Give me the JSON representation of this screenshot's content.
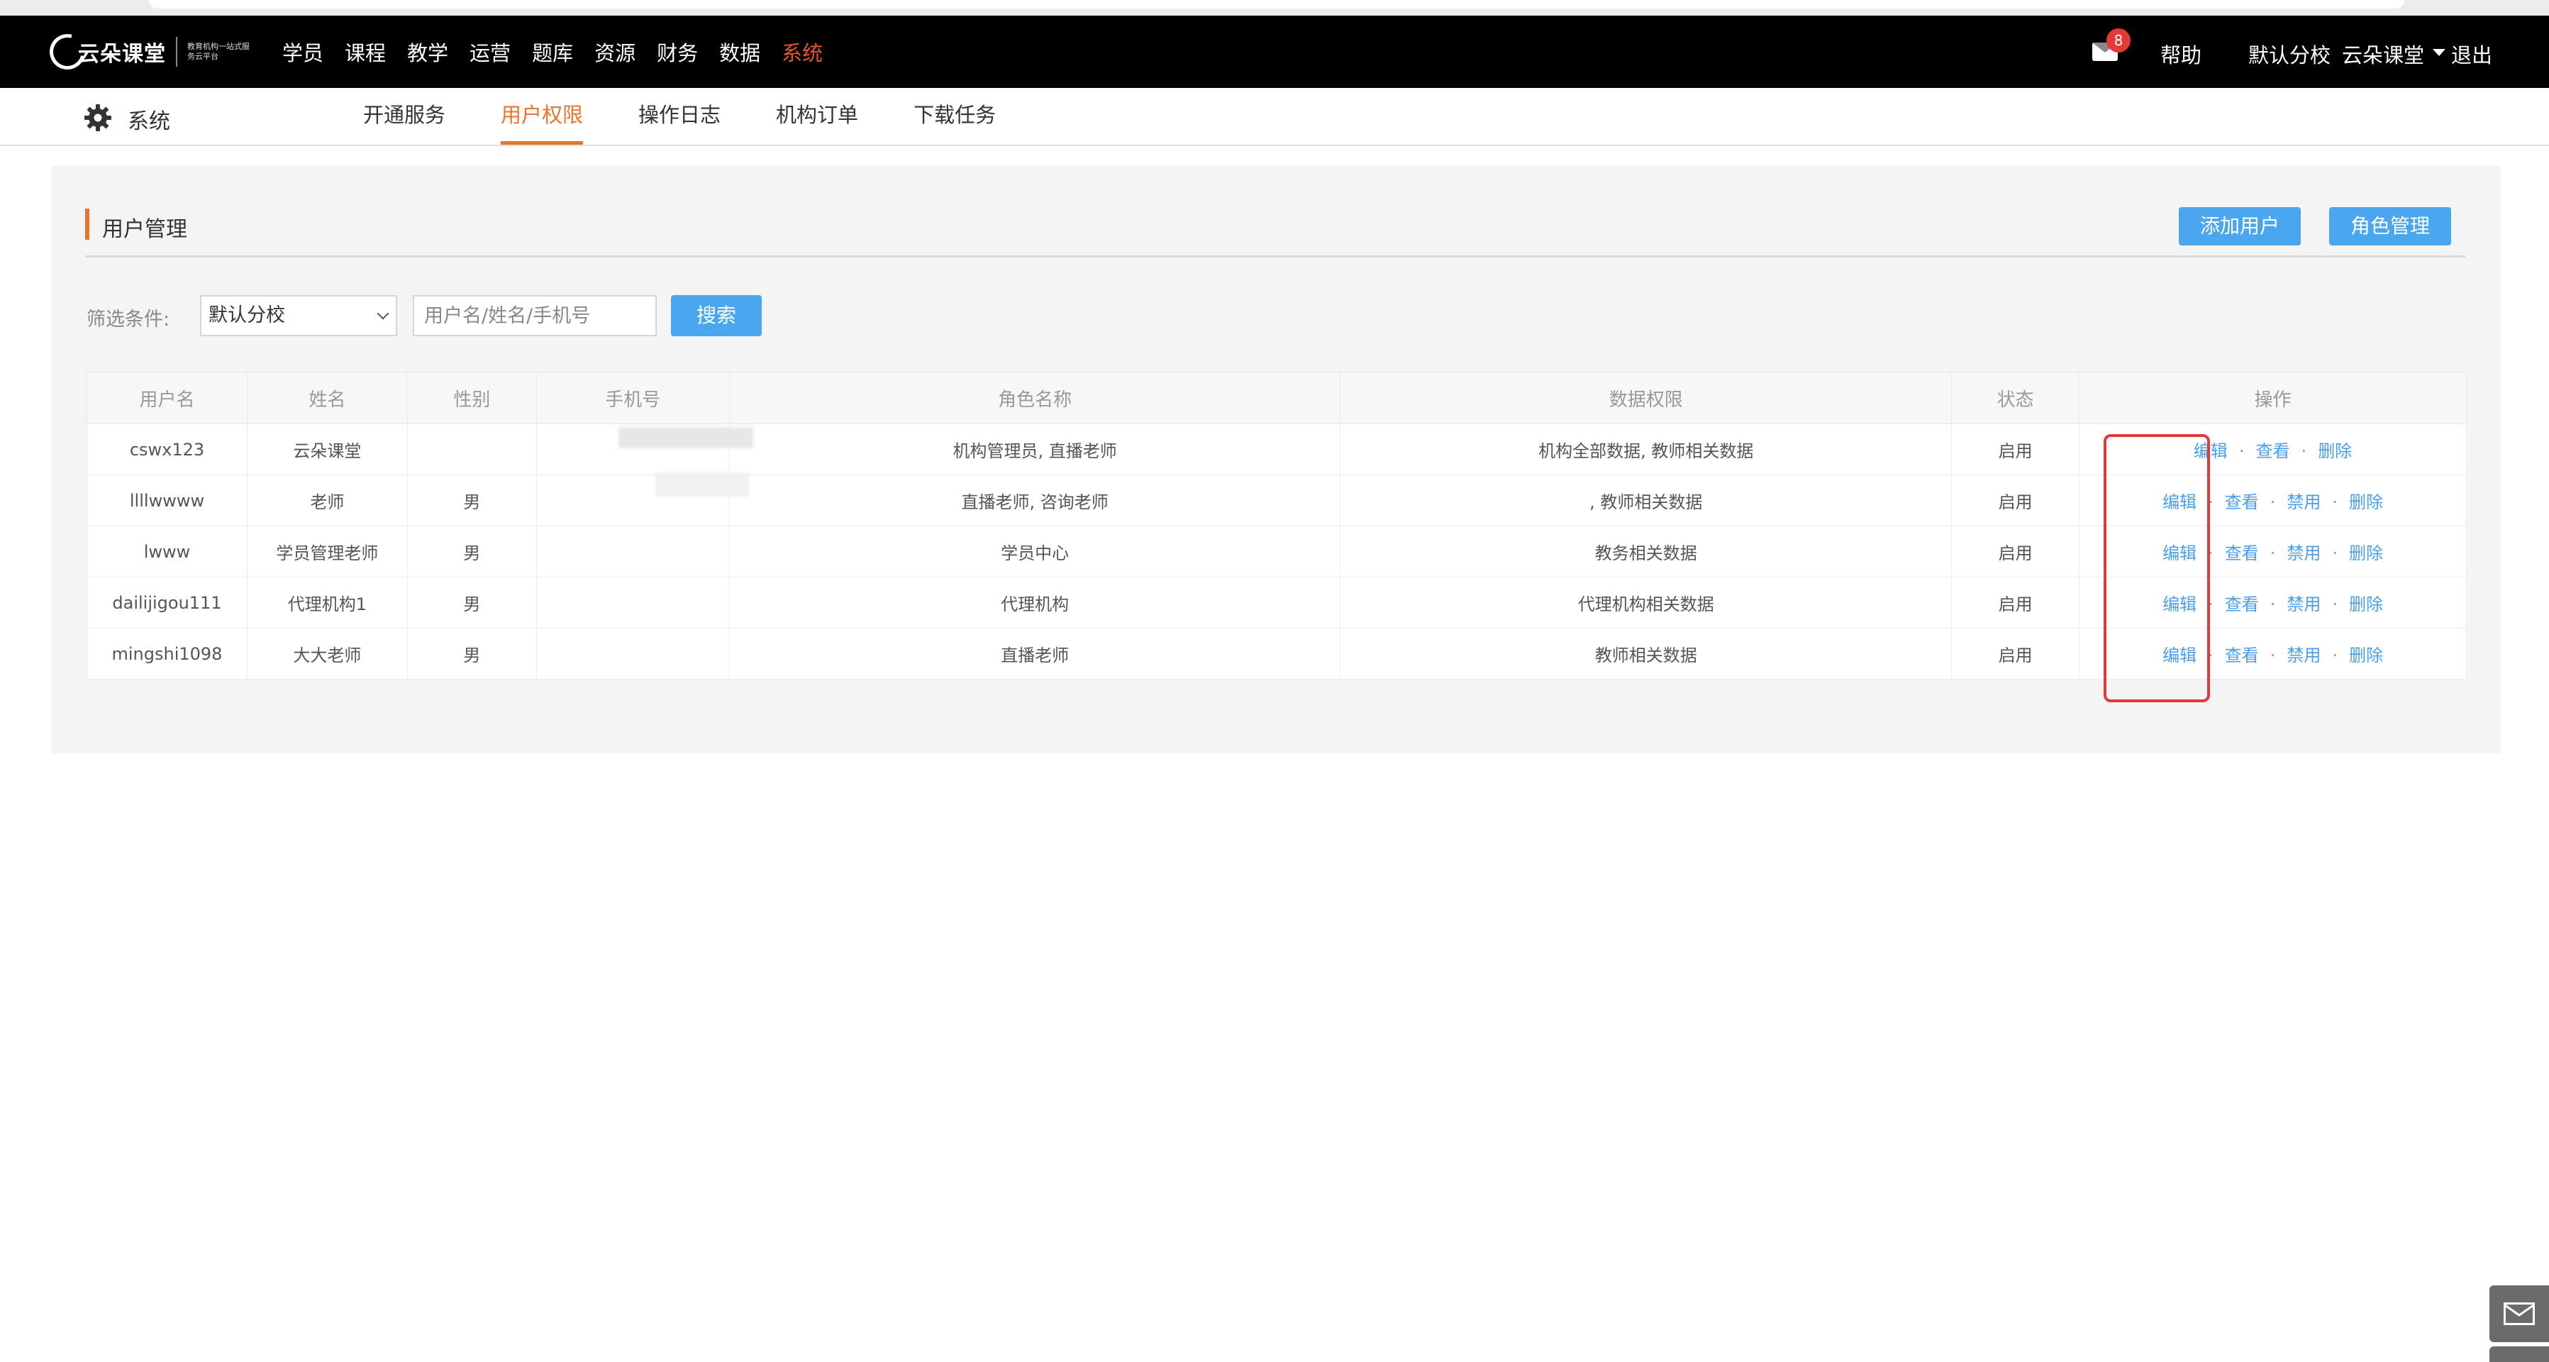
{
  "brand": {
    "name": "云朵课堂",
    "tagline": "教育机构一站式服务云平台"
  },
  "topnav": {
    "items": [
      "学员",
      "课程",
      "教学",
      "运营",
      "题库",
      "资源",
      "财务",
      "数据",
      "系统"
    ],
    "active": "系统"
  },
  "header_right": {
    "message_count": "8",
    "help": "帮助",
    "branch": "默认分校",
    "account": "云朵课堂",
    "logout": "退出"
  },
  "module": {
    "title": "系统",
    "tabs": [
      "开通服务",
      "用户权限",
      "操作日志",
      "机构订单",
      "下载任务"
    ],
    "active_tab": "用户权限"
  },
  "panel": {
    "title": "用户管理",
    "add_user": "添加用户",
    "role_manage": "角色管理"
  },
  "filter": {
    "label": "筛选条件:",
    "branch_selected": "默认分校",
    "search_placeholder": "用户名/姓名/手机号",
    "search_button": "搜索"
  },
  "table": {
    "columns": [
      "用户名",
      "姓名",
      "性别",
      "手机号",
      "角色名称",
      "数据权限",
      "状态",
      "操作"
    ],
    "rows": [
      {
        "username": "cswx123",
        "name": "云朵课堂",
        "gender": "",
        "phone": "",
        "roles": "机构管理员, 直播老师",
        "data_scope": "机构全部数据, 教师相关数据",
        "status": "启用",
        "ops": [
          "编辑",
          "查看",
          "删除"
        ]
      },
      {
        "username": "llllwwww",
        "name": "老师",
        "gender": "男",
        "phone": "",
        "roles": "直播老师, 咨询老师",
        "data_scope": ", 教师相关数据",
        "status": "启用",
        "ops": [
          "编辑",
          "查看",
          "禁用",
          "删除"
        ]
      },
      {
        "username": "lwww",
        "name": "学员管理老师",
        "gender": "男",
        "phone": "",
        "roles": "学员中心",
        "data_scope": "教务相关数据",
        "status": "启用",
        "ops": [
          "编辑",
          "查看",
          "禁用",
          "删除"
        ]
      },
      {
        "username": "dailijigou111",
        "name": "代理机构1",
        "gender": "男",
        "phone": "",
        "roles": "代理机构",
        "data_scope": "代理机构相关数据",
        "status": "启用",
        "ops": [
          "编辑",
          "查看",
          "禁用",
          "删除"
        ]
      },
      {
        "username": "mingshi1098",
        "name": "大大老师",
        "gender": "男",
        "phone": "",
        "roles": "直播老师",
        "data_scope": "教师相关数据",
        "status": "启用",
        "ops": [
          "编辑",
          "查看",
          "禁用",
          "删除"
        ]
      }
    ]
  },
  "colors": {
    "accent_orange": "#e8742c",
    "nav_active_red": "#e8542c",
    "button_blue": "#4aa6ee",
    "link_blue": "#4a9fe8",
    "highlight_red": "#e53935"
  },
  "icons": {
    "message": "mail-icon",
    "system": "gear-icon",
    "float_contact": "mail-icon"
  }
}
